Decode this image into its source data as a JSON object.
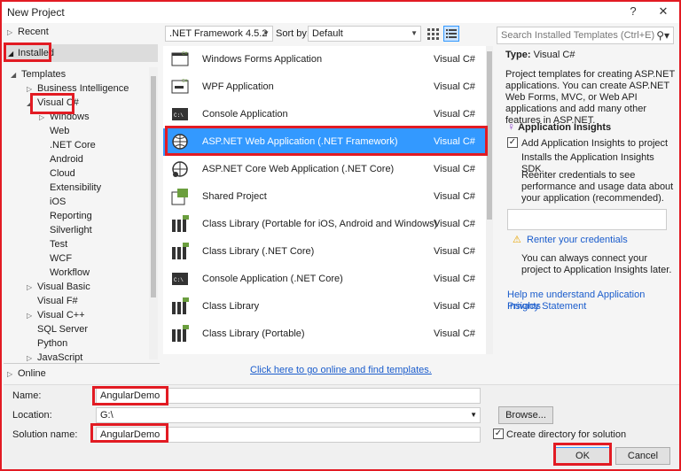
{
  "window": {
    "title": "New Project",
    "help": "?",
    "close": "✕"
  },
  "tree": {
    "recent": "Recent",
    "installed": "Installed",
    "templates": "Templates",
    "items": [
      {
        "label": "Business Intelligence",
        "arrow": "▷"
      },
      {
        "label": "Visual C#",
        "arrow": "◢"
      },
      {
        "label": "Windows",
        "arrow": "▷"
      },
      {
        "label": "Web",
        "arrow": ""
      },
      {
        "label": ".NET Core",
        "arrow": ""
      },
      {
        "label": "Android",
        "arrow": ""
      },
      {
        "label": "Cloud",
        "arrow": ""
      },
      {
        "label": "Extensibility",
        "arrow": ""
      },
      {
        "label": "iOS",
        "arrow": ""
      },
      {
        "label": "Reporting",
        "arrow": ""
      },
      {
        "label": "Silverlight",
        "arrow": ""
      },
      {
        "label": "Test",
        "arrow": ""
      },
      {
        "label": "WCF",
        "arrow": ""
      },
      {
        "label": "Workflow",
        "arrow": ""
      },
      {
        "label": "Visual Basic",
        "arrow": "▷"
      },
      {
        "label": "Visual F#",
        "arrow": ""
      },
      {
        "label": "Visual C++",
        "arrow": "▷"
      },
      {
        "label": "SQL Server",
        "arrow": ""
      },
      {
        "label": "Python",
        "arrow": ""
      },
      {
        "label": "JavaScript",
        "arrow": "▷"
      }
    ],
    "online": "Online"
  },
  "toolbar": {
    "framework": ".NET Framework 4.5.2",
    "sort_label": "Sort by:",
    "sort_value": "Default"
  },
  "search": {
    "placeholder": "Search Installed Templates (Ctrl+E)"
  },
  "templates": [
    {
      "name": "Windows Forms Application",
      "lang": "Visual C#",
      "icon": "winforms-icon"
    },
    {
      "name": "WPF Application",
      "lang": "Visual C#",
      "icon": "wpf-icon"
    },
    {
      "name": "Console Application",
      "lang": "Visual C#",
      "icon": "console-icon"
    },
    {
      "name": "ASP.NET Web Application (.NET Framework)",
      "lang": "Visual C#",
      "icon": "globe-icon"
    },
    {
      "name": "ASP.NET Core Web Application (.NET Core)",
      "lang": "Visual C#",
      "icon": "globe-core-icon"
    },
    {
      "name": "Shared Project",
      "lang": "Visual C#",
      "icon": "shared-project-icon"
    },
    {
      "name": "Class Library (Portable for iOS, Android and Windows)",
      "lang": "Visual C#",
      "icon": "class-library-icon"
    },
    {
      "name": "Class Library (.NET Core)",
      "lang": "Visual C#",
      "icon": "class-library-icon"
    },
    {
      "name": "Console Application (.NET Core)",
      "lang": "Visual C#",
      "icon": "console-icon"
    },
    {
      "name": "Class Library",
      "lang": "Visual C#",
      "icon": "class-library-icon"
    },
    {
      "name": "Class Library (Portable)",
      "lang": "Visual C#",
      "icon": "class-library-icon"
    }
  ],
  "online_link": "Click here to go online and find templates.",
  "details": {
    "type_label": "Type:",
    "type_value": "Visual C#",
    "description": "Project templates for creating ASP.NET applications. You can create ASP.NET Web Forms, MVC, or Web API applications and add many other features in ASP.NET.",
    "insights_title": "Application Insights",
    "add_insights": "Add Application Insights to project",
    "installs_sdk": "Installs the Application Insights SDK.",
    "reenter_text": "Reenter credentials to see performance and usage data about your application (recommended).",
    "reenter_link": "Renter your credentials",
    "connect_later": "You can always connect your project to Application Insights later.",
    "help_link": "Help me understand Application Insights",
    "privacy_link": "Privacy Statement"
  },
  "form": {
    "name_label": "Name:",
    "name_value": "AngularDemo",
    "location_label": "Location:",
    "location_value": "G:\\",
    "solution_label": "Solution name:",
    "solution_value": "AngularDemo",
    "browse": "Browse...",
    "create_dir": "Create directory for solution",
    "ok": "OK",
    "cancel": "Cancel"
  }
}
